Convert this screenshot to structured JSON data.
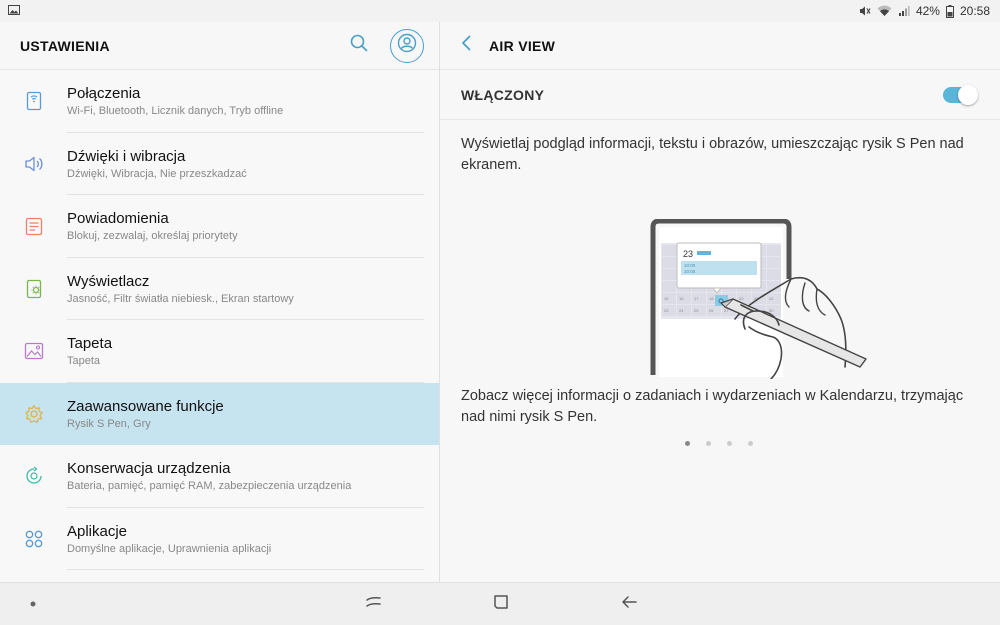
{
  "status_bar": {
    "battery_text": "42%",
    "time": "20:58",
    "icons": [
      "gallery-notification-icon",
      "mute-icon",
      "wifi-icon",
      "signal-icon",
      "battery-icon"
    ]
  },
  "left_panel": {
    "title": "USTAWIENIA",
    "search_icon": "search-icon",
    "account_icon": "account-icon",
    "items": [
      {
        "title": "Połączenia",
        "subtitle": "Wi-Fi, Bluetooth, Licznik danych, Tryb offline",
        "icon": "connections-icon",
        "icon_color": "#5b9bd5"
      },
      {
        "title": "Dźwięki i wibracja",
        "subtitle": "Dźwięki, Wibracja, Nie przeszkadzać",
        "icon": "speaker-icon",
        "icon_color": "#6c8fd9"
      },
      {
        "title": "Powiadomienia",
        "subtitle": "Blokuj, zezwalaj, określaj priorytety",
        "icon": "notifications-icon",
        "icon_color": "#e8826b"
      },
      {
        "title": "Wyświetlacz",
        "subtitle": "Jasność, Filtr światła niebiesk., Ekran startowy",
        "icon": "display-icon",
        "icon_color": "#7ab648"
      },
      {
        "title": "Tapeta",
        "subtitle": "Tapeta",
        "icon": "wallpaper-icon",
        "icon_color": "#b77ac9"
      },
      {
        "title": "Zaawansowane funkcje",
        "subtitle": "Rysik S Pen, Gry",
        "icon": "advanced-features-icon",
        "icon_color": "#e0b24a"
      },
      {
        "title": "Konserwacja urządzenia",
        "subtitle": "Bateria, pamięć, pamięć RAM, zabezpieczenia urządzenia",
        "icon": "device-care-icon",
        "icon_color": "#3fb9a8"
      },
      {
        "title": "Aplikacje",
        "subtitle": "Domyślne aplikacje, Uprawnienia aplikacji",
        "icon": "apps-icon",
        "icon_color": "#5b9bd5"
      }
    ],
    "selected_index": 5
  },
  "right_panel": {
    "title": "AIR VIEW",
    "back_icon": "back-chevron-icon",
    "toggle_label": "WŁĄCZONY",
    "toggle_on": true,
    "toggle_color": "#5ab6d9",
    "description": "Wyświetlaj podgląd informacji, tekstu i obrazów, umieszczając rysik S Pen nad ekranem.",
    "illustration_date": "23",
    "illustration_times": [
      "10:00",
      "10:00"
    ],
    "illustration_grid": [
      "15",
      "16",
      "17",
      "18",
      "19",
      "20",
      "21",
      "22",
      "23",
      "24",
      "25",
      "26",
      "27",
      "28",
      "29",
      "30"
    ],
    "slide_text": "Zobacz więcej informacji o zadaniach i wydarzeniach w Kalendarzu, trzymając nad nimi rysik S Pen.",
    "page_count": 4,
    "active_page": 0
  },
  "nav_bar": {
    "icons": [
      "nav-dot-icon",
      "recents-icon",
      "home-icon",
      "back-icon"
    ]
  }
}
